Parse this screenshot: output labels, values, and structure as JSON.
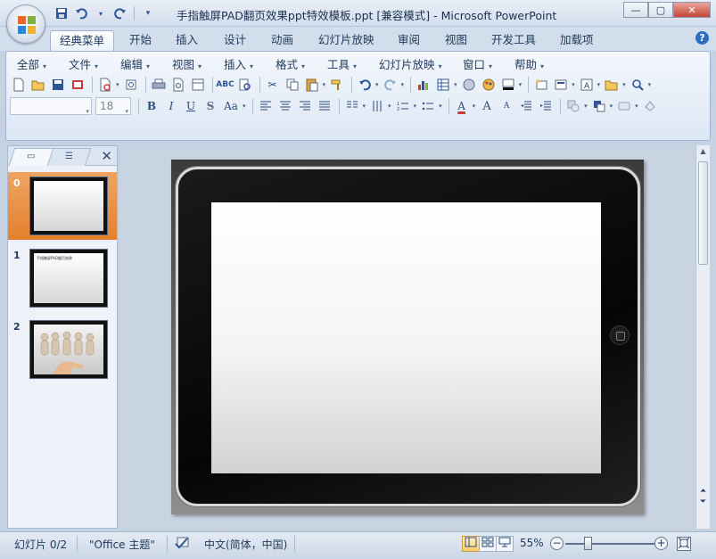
{
  "window": {
    "title": "手指触屏PAD翻页效果ppt特效模板.ppt [兼容模式] - Microsoft PowerPoint",
    "minimize": "—",
    "maximize": "▢",
    "close": "✕"
  },
  "quick_access": [
    "save-icon",
    "undo-icon",
    "redo-icon",
    "customize-icon"
  ],
  "ribbon_tabs": [
    "经典菜单",
    "开始",
    "插入",
    "设计",
    "动画",
    "幻灯片放映",
    "审阅",
    "视图",
    "开发工具",
    "加载项"
  ],
  "active_tab": "经典菜单",
  "classic_menu": [
    "全部",
    "文件",
    "编辑",
    "视图",
    "插入",
    "格式",
    "工具",
    "幻灯片放映",
    "窗口",
    "帮助"
  ],
  "format_bar": {
    "font_name": "",
    "font_size": "18",
    "bold": "B",
    "italic": "I",
    "underline": "U",
    "shadow": "S",
    "change_case": "Aa",
    "font_color": "A",
    "grow": "A",
    "shrink": "A"
  },
  "panel": {
    "tab_slides": "▭",
    "tab_outline": "☰",
    "close": "✕"
  },
  "slides": [
    {
      "number": "0",
      "selected": true,
      "caption": ""
    },
    {
      "number": "1",
      "selected": false,
      "caption": "手指触屏PAD翻页效果"
    },
    {
      "number": "2",
      "selected": false,
      "caption": ""
    }
  ],
  "statusbar": {
    "slide_info": "幻灯片 0/2",
    "theme": "\"Office 主题\"",
    "language": "中文(简体，中国)",
    "zoom": "55%",
    "zoom_out": "−",
    "zoom_in": "+"
  },
  "colors": {
    "selected_slide": "#e4802d",
    "ribbon_bg": "#dde7f4",
    "office_blue": "#2b5797"
  }
}
